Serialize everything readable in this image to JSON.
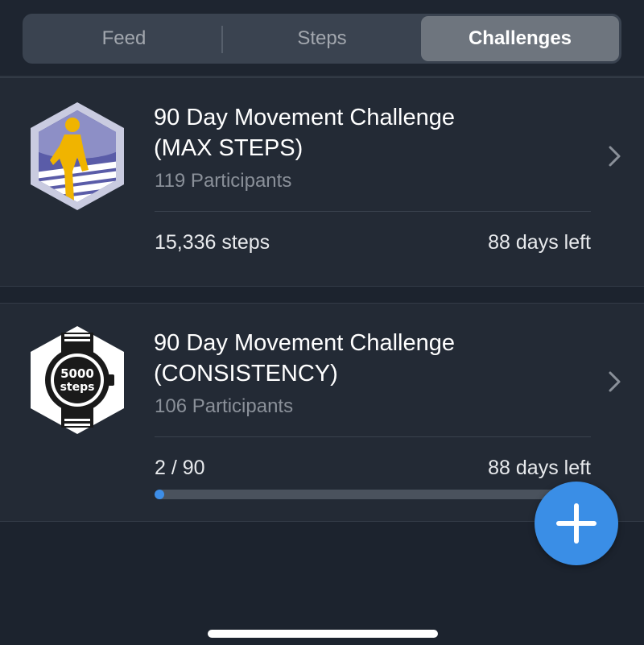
{
  "tabs": {
    "feed": "Feed",
    "steps": "Steps",
    "challenges": "Challenges",
    "active": "Challenges"
  },
  "challenges": [
    {
      "title_line1": "90 Day Movement Challenge",
      "title_line2": "(MAX STEPS)",
      "participants": "119 Participants",
      "stat": "15,336 steps",
      "days_left": "88 days left",
      "badge_icon": "runner-badge-icon"
    },
    {
      "title_line1": "90 Day Movement Challenge",
      "title_line2": "(CONSISTENCY)",
      "participants": "106 Participants",
      "stat": "2 / 90",
      "days_left": "88 days left",
      "badge_icon": "watch-badge-icon",
      "badge_text_line1": "5000",
      "badge_text_line2": "steps",
      "progress_fraction": 0.022
    }
  ],
  "colors": {
    "accent": "#3a8ee6",
    "background": "#1c232e",
    "card": "#232a35"
  },
  "fab": {
    "icon": "plus-icon"
  }
}
